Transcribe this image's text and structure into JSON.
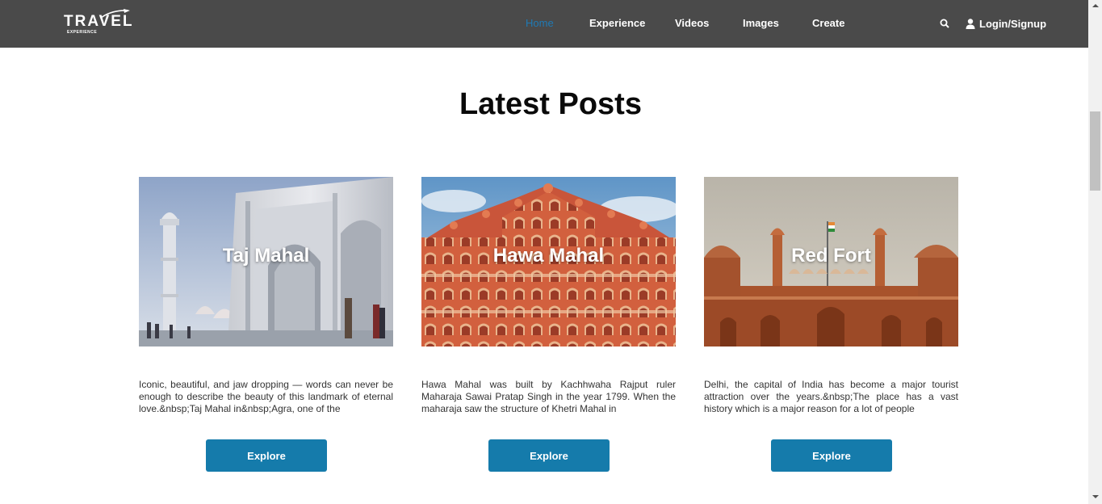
{
  "header": {
    "logo_text": "TRAVEL",
    "logo_subtext": "EXPERIENCE",
    "nav": [
      {
        "label": "Home",
        "active": true
      },
      {
        "label": "Experience",
        "active": false
      },
      {
        "label": "Videos",
        "active": false
      },
      {
        "label": "Images",
        "active": false
      },
      {
        "label": "Create",
        "active": false
      }
    ],
    "search_icon": "search-icon",
    "login_label": "Login/Signup",
    "login_icon": "user-icon"
  },
  "main": {
    "title": "Latest Posts",
    "posts": [
      {
        "title": "Taj Mahal",
        "excerpt": "Iconic, beautiful, and jaw dropping — words can never be enough to describe the beauty of this landmark of eternal love.&nbsp;Taj Mahal in&nbsp;Agra, one of the",
        "button_label": "Explore"
      },
      {
        "title": "Hawa Mahal",
        "excerpt": "Hawa Mahal was built by Kachhwaha Rajput ruler Maharaja Sawai Pratap Singh in the year 1799. When the maharaja saw the structure of Khetri Mahal in",
        "button_label": "Explore"
      },
      {
        "title": "Red Fort",
        "excerpt": "Delhi, the capital of India has become a major tourist attraction over the years.&nbsp;The place has a vast history which is a major reason for a lot of people",
        "button_label": "Explore"
      }
    ]
  },
  "colors": {
    "navbar_bg": "#4a4a4a",
    "nav_active": "#1f7ab5",
    "button_bg": "#157bab"
  }
}
